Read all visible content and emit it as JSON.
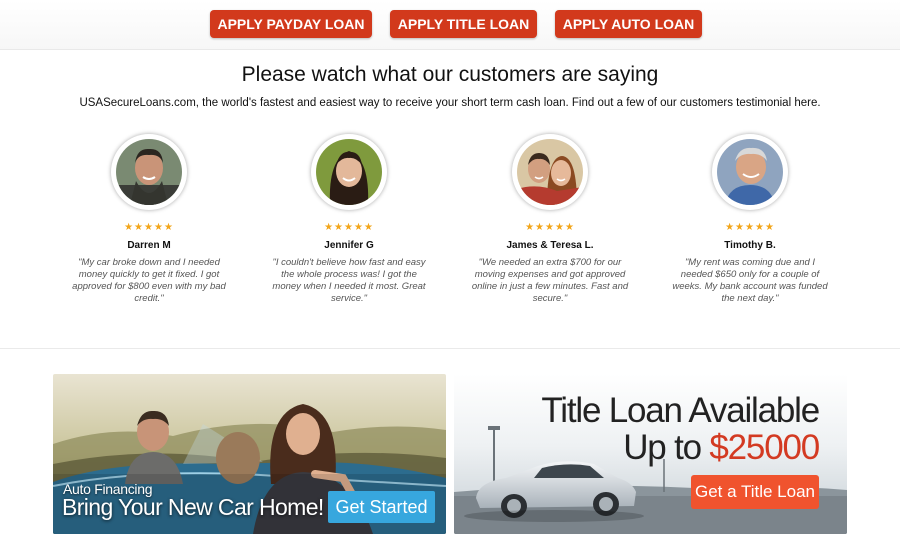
{
  "top_buttons": {
    "payday": "APPLY PAYDAY LOAN",
    "title": "APPLY TITLE LOAN",
    "auto": "APPLY AUTO LOAN",
    "color": "#d2391c"
  },
  "testimonials_section": {
    "title": "Please watch what our customers are saying",
    "subtitle": "USASecureLoans.com, the world's fastest and easiest way to receive your short term cash loan. Find out a few of our customers testimonial here.",
    "items": [
      {
        "name": "Darren M",
        "rating": 5,
        "stars": "★★★★★",
        "quote": "\"My car broke down and I needed money quickly to get it fixed. I got approved for $800 even with my bad credit.\""
      },
      {
        "name": "Jennifer G",
        "rating": 5,
        "stars": "★★★★★",
        "quote": "\"I couldn't believe how fast and easy the whole process was! I got the money when I needed it most. Great service.\""
      },
      {
        "name": "James & Teresa L.",
        "rating": 5,
        "stars": "★★★★★",
        "quote": "\"We needed an extra $700 for our moving expenses and got approved online in just a few minutes. Fast and secure.\""
      },
      {
        "name": "Timothy B.",
        "rating": 5,
        "stars": "★★★★★",
        "quote": "\"My rent was coming due and I needed $650 only for a couple of weeks. My bank account was funded the next day.\""
      }
    ],
    "star_color": "#f2a51a"
  },
  "auto_banner": {
    "label": "Auto Financing",
    "headline": "Bring Your New Car Home!",
    "button": "Get Started",
    "button_color": "#37a7de"
  },
  "title_banner": {
    "line1": "Title Loan Available",
    "line2_prefix": "Up to",
    "amount": "$25000",
    "button": "Get a Title Loan",
    "amount_color": "#d33a22",
    "button_color": "#f0532e"
  }
}
